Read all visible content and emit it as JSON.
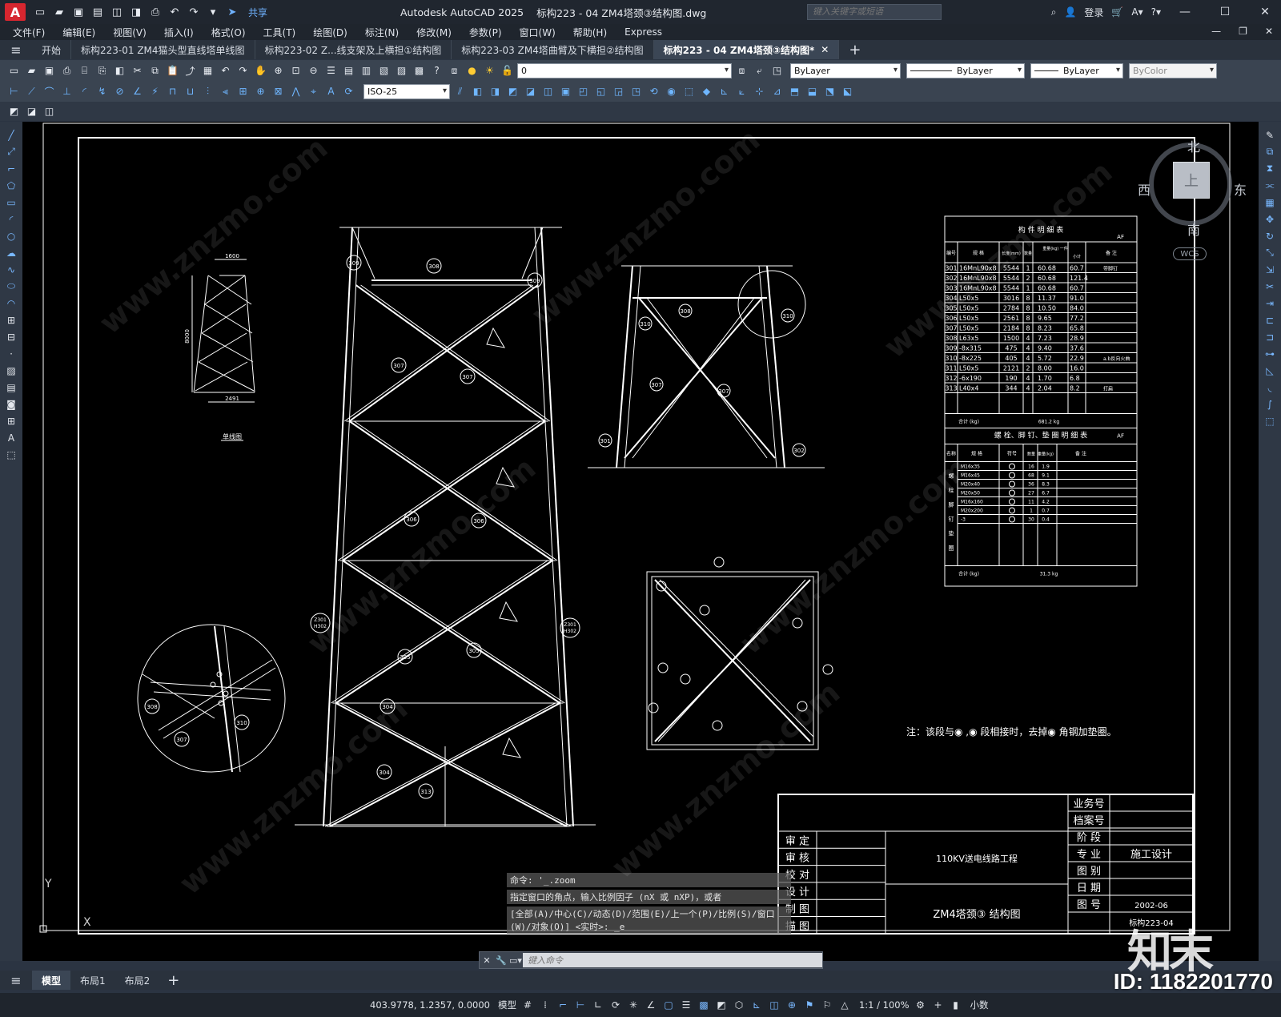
{
  "app": {
    "logo": "A",
    "title": "Autodesk AutoCAD 2025",
    "doc": "标构223 - 04 ZM4塔颈③结构图.dwg",
    "share": "共享",
    "search_placeholder": "键入关键字或短语",
    "login": "登录"
  },
  "menu": [
    "文件(F)",
    "编辑(E)",
    "视图(V)",
    "插入(I)",
    "格式(O)",
    "工具(T)",
    "绘图(D)",
    "标注(N)",
    "修改(M)",
    "参数(P)",
    "窗口(W)",
    "帮助(H)",
    "Express"
  ],
  "tabs": [
    {
      "label": "开始",
      "active": false
    },
    {
      "label": "标构223-01 ZM4猫头型直线塔单线图",
      "active": false
    },
    {
      "label": "标构223-02 Z...线支架及上横担①结构图",
      "active": false
    },
    {
      "label": "标构223-03 ZM4塔曲臂及下横担②结构图",
      "active": false
    },
    {
      "label": "标构223 - 04 ZM4塔颈③结构图*",
      "active": true
    }
  ],
  "properties": {
    "layer": "0",
    "color": "ByLayer",
    "linetype": "ByLayer",
    "lineweight": "ByLayer",
    "plotstyle": "ByColor",
    "dimstyle": "ISO-25"
  },
  "viewcube": {
    "north": "北",
    "south": "南",
    "west": "西",
    "east": "东",
    "face": "上",
    "wcs": "WCS"
  },
  "drawing": {
    "parts_table_title": "构 件 明 细 表",
    "parts_headers": [
      "编号",
      "规 格",
      "长度(mm)",
      "数量",
      "重量(kg) 一件",
      "小计",
      "备 注"
    ],
    "parts_rows": [
      [
        "301",
        "16MnL90x8",
        "5544",
        "1",
        "60.68",
        "60.7",
        "带脚钉"
      ],
      [
        "302",
        "16MnL90x8",
        "5544",
        "2",
        "60.68",
        "121.4",
        ""
      ],
      [
        "303",
        "16MnL90x8",
        "5544",
        "1",
        "60.68",
        "60.7",
        ""
      ],
      [
        "304",
        "L50x5",
        "3016",
        "8",
        "11.37",
        "91.0",
        ""
      ],
      [
        "305",
        "L50x5",
        "2784",
        "8",
        "10.50",
        "84.0",
        ""
      ],
      [
        "306",
        "L50x5",
        "2561",
        "8",
        "9.65",
        "77.2",
        ""
      ],
      [
        "307",
        "L50x5",
        "2184",
        "8",
        "8.23",
        "65.8",
        ""
      ],
      [
        "308",
        "L63x5",
        "1500",
        "4",
        "7.23",
        "28.9",
        ""
      ],
      [
        "309",
        "-8x315",
        "475",
        "4",
        "9.40",
        "37.6",
        ""
      ],
      [
        "310",
        "-8x225",
        "405",
        "4",
        "5.72",
        "22.9",
        "a.b反向火曲"
      ],
      [
        "311",
        "L50x5",
        "2121",
        "2",
        "8.00",
        "16.0",
        ""
      ],
      [
        "312",
        "-6x190",
        "190",
        "4",
        "1.70",
        "6.8",
        ""
      ],
      [
        "313",
        "L40x4",
        "344",
        "4",
        "2.04",
        "8.2",
        "打扁"
      ]
    ],
    "parts_total": [
      "合计 (kg)",
      "681.2 kg"
    ],
    "bolt_table_title": "螺 栓、脚 钉、垫 圈 明 细 表",
    "bolt_headers": [
      "名称",
      "规 格",
      "符号",
      "数量",
      "重量(kg)",
      "备 注"
    ],
    "bolt_rows": [
      [
        "M16x35",
        "16",
        "1.9"
      ],
      [
        "M16x45",
        "68",
        "9.1"
      ],
      [
        "M20x40",
        "36",
        "8.3"
      ],
      [
        "M20x50",
        "27",
        "6.7"
      ],
      [
        "M16x160",
        "11",
        "4.2"
      ],
      [
        "M20x200",
        "1",
        "0.7"
      ],
      [
        "-3",
        "30",
        "0.4"
      ]
    ],
    "bolt_total": [
      "合计 (kg)",
      "31.3 kg"
    ],
    "af_mark": "AF",
    "bolt_groups": [
      "螺",
      "栓",
      "脚",
      "钉",
      "垫",
      "圈"
    ],
    "note": "注：该段与◉ ,◉ 段相接时，去掉◉ 角钢加垫圈。",
    "single_line_label": "单线图",
    "dims": {
      "top": "1600",
      "height": "8000",
      "bottom": "2491"
    },
    "title_block": {
      "left_labels": [
        "审 定",
        "审 核",
        "校 对",
        "设 计",
        "制 图",
        "描 图"
      ],
      "project": "110KV送电线路工程",
      "drawing_name": "ZM4塔颈③ 结构图",
      "right_labels": [
        "业务号",
        "档案号",
        "阶 段",
        "专 业",
        "图 别",
        "日 期",
        "图 号"
      ],
      "stage_value": "施工设计",
      "date_value": "2002-06",
      "number_value": "标构223-04"
    }
  },
  "command": {
    "history": [
      "命令: '_.zoom",
      "指定窗口的角点，输入比例因子 (nX 或 nXP)，或者",
      "[全部(A)/中心(C)/动态(D)/范围(E)/上一个(P)/比例(S)/窗口(W)/对象(O)] <实时>: _e"
    ],
    "placeholder": "键入命令"
  },
  "ucs": {
    "x": "X",
    "y": "Y"
  },
  "layouts": [
    {
      "label": "模型",
      "active": true
    },
    {
      "label": "布局1",
      "active": false
    },
    {
      "label": "布局2",
      "active": false
    }
  ],
  "status": {
    "coords": "403.9778, 1.2357, 0.0000",
    "mode": "模型",
    "scale": "1:1 / 100%",
    "units": "小数"
  },
  "watermark": {
    "site": "www.znzmo.com",
    "brand": "知末",
    "id": "ID: 1182201770"
  },
  "colors": {
    "canvas": "#000000",
    "toolbar": "#3a4451",
    "titlebar": "#20262f",
    "accent": "#d6262f"
  }
}
